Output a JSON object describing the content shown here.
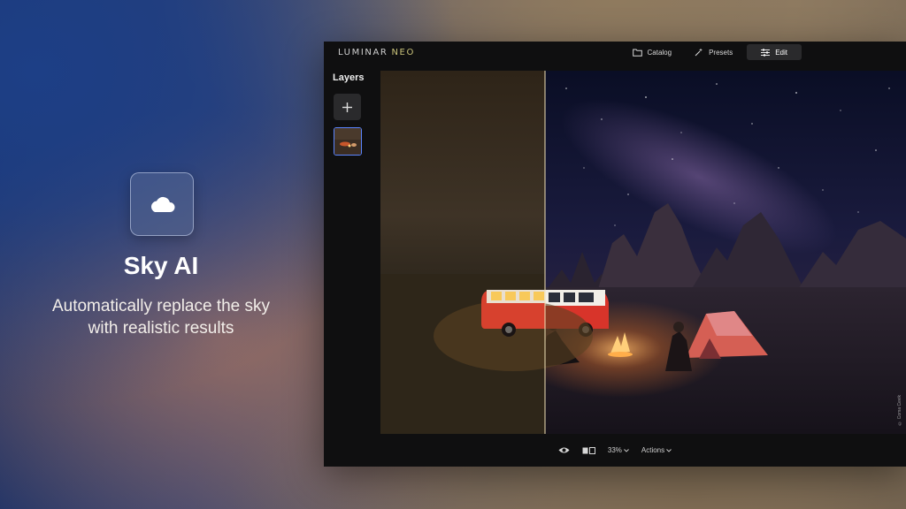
{
  "promo": {
    "icon": "cloud-icon",
    "title": "Sky AI",
    "description_line1": "Automatically replace the sky",
    "description_line2": "with realistic results"
  },
  "app": {
    "logo_main": "LUMINAR",
    "logo_accent": "NEO",
    "nav": [
      {
        "label": "Catalog",
        "icon": "folder-icon"
      },
      {
        "label": "Presets",
        "icon": "magic-wand-icon"
      },
      {
        "label": "Edit",
        "icon": "sliders-icon",
        "active": true
      }
    ],
    "layers_title": "Layers",
    "bottom": {
      "zoom": "33%",
      "actions": "Actions"
    },
    "photo_credit": "© Coma Cevik"
  },
  "colors": {
    "accent_blue": "#5b85ff",
    "window_bg": "#0f0f10"
  }
}
